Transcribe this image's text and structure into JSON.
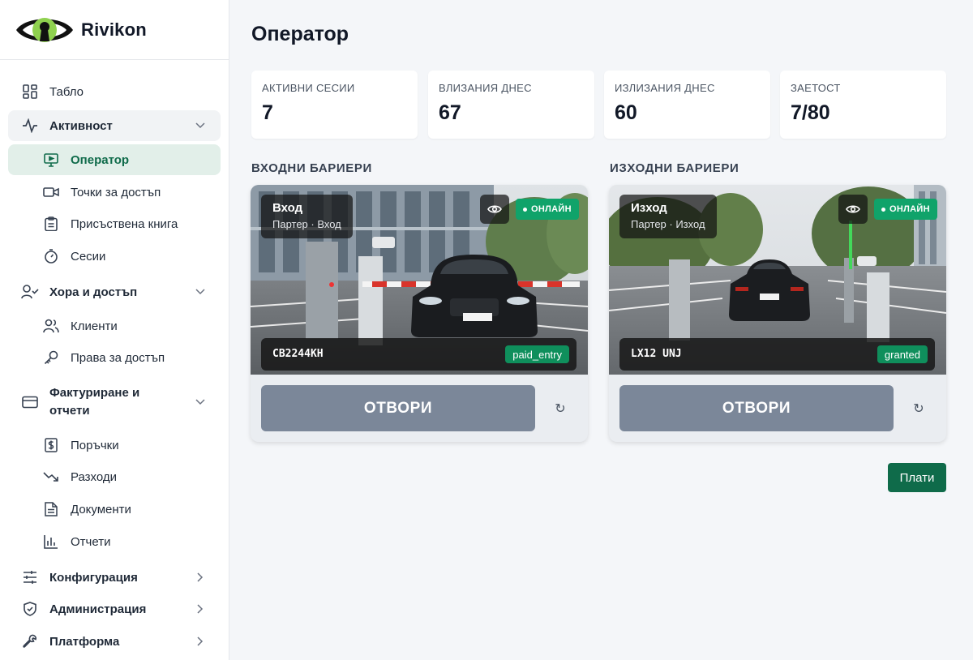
{
  "brand": {
    "name": "Rivikon"
  },
  "sidebar": {
    "items": [
      {
        "label": "Табло",
        "icon": "dashboard-icon"
      },
      {
        "label": "Активност",
        "icon": "activity-icon"
      },
      {
        "label": "Оператор",
        "icon": "monitor-icon"
      },
      {
        "label": "Точки за достъп",
        "icon": "camera-icon"
      },
      {
        "label": "Присъствена книга",
        "icon": "clipboard-icon"
      },
      {
        "label": "Сесии",
        "icon": "timer-icon"
      },
      {
        "label": "Хора и достъп",
        "icon": "user-check-icon"
      },
      {
        "label": "Клиенти",
        "icon": "users-icon"
      },
      {
        "label": "Права за достъп",
        "icon": "key-icon"
      },
      {
        "label": "Фактуриране и отчети",
        "icon": "credit-card-icon"
      },
      {
        "label": "Поръчки",
        "icon": "dollar-file-icon"
      },
      {
        "label": "Разходи",
        "icon": "trending-down-icon"
      },
      {
        "label": "Документи",
        "icon": "file-text-icon"
      },
      {
        "label": "Отчети",
        "icon": "bar-chart-icon"
      },
      {
        "label": "Конфигурация",
        "icon": "sliders-icon"
      },
      {
        "label": "Администрация",
        "icon": "shield-icon"
      },
      {
        "label": "Платформа",
        "icon": "wrench-icon"
      }
    ]
  },
  "page": {
    "title": "Оператор"
  },
  "stats": [
    {
      "label": "АКТИВНИ СЕСИИ",
      "value": "7"
    },
    {
      "label": "ВЛИЗАНИЯ ДНЕС",
      "value": "67"
    },
    {
      "label": "ИЗЛИЗАНИЯ ДНЕС",
      "value": "60"
    },
    {
      "label": "ЗАЕТОСТ",
      "value": "7/80"
    }
  ],
  "sections": {
    "entry": "ВХОДНИ БАРИЕРИ",
    "exit": "ИЗХОДНИ БАРИЕРИ"
  },
  "barriers": [
    {
      "name": "Вход",
      "location": "Партер · Вход",
      "status": "ОНЛАЙН",
      "plate": "CB2244KH",
      "badge": "paid_entry",
      "open_label": "ОТВОРИ",
      "refresh_glyph": "↻"
    },
    {
      "name": "Изход",
      "location": "Партер · Изход",
      "status": "ОНЛАЙН",
      "plate": "LX12 UNJ",
      "badge": "granted",
      "open_label": "ОТВОРИ",
      "refresh_glyph": "↻"
    }
  ],
  "actions": {
    "pay_label": "Плати"
  },
  "colors": {
    "brand_green": "#0f6b4a",
    "online_green": "#10a36a",
    "logo_green": "#8fd14f",
    "open_button": "#7b8799"
  }
}
